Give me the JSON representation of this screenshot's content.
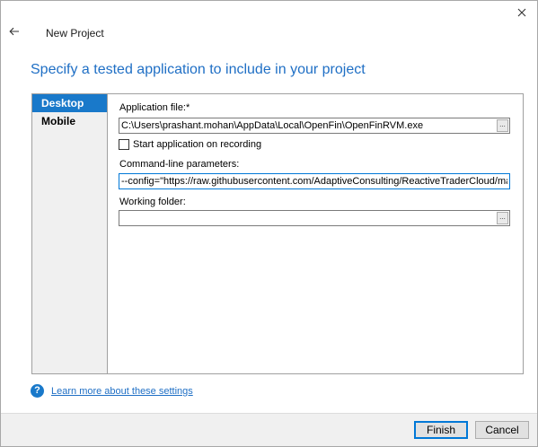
{
  "window": {
    "title": "New Project",
    "heading": "Specify a tested application to include in your project"
  },
  "tabs": [
    {
      "label": "Desktop",
      "active": true
    },
    {
      "label": "Mobile",
      "active": false
    }
  ],
  "form": {
    "app_file_label": "Application file:*",
    "app_file_value": "C:\\Users\\prashant.mohan\\AppData\\Local\\OpenFin\\OpenFinRVM.exe",
    "start_on_recording_label": "Start application on recording",
    "start_on_recording_checked": false,
    "cmdline_label": "Command-line parameters:",
    "cmdline_value": "--config=\"https://raw.githubusercontent.com/AdaptiveConsulting/ReactiveTraderCloud/master/src/client",
    "working_folder_label": "Working folder:",
    "working_folder_value": "",
    "browse_label": "..."
  },
  "help": {
    "icon": "?",
    "link_text": "Learn more about these settings"
  },
  "buttons": {
    "finish": "Finish",
    "cancel": "Cancel"
  },
  "colors": {
    "accent": "#1979ca",
    "heading": "#1f6fc5"
  }
}
